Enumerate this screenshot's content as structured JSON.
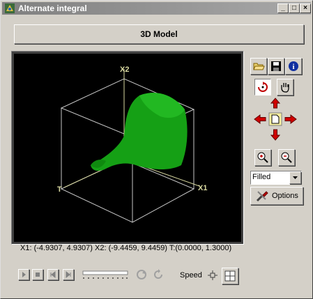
{
  "window": {
    "title": "Alternate integral"
  },
  "titlebar": {
    "minimize": "_",
    "maximize": "□",
    "close": "×"
  },
  "header": {
    "model_label": "3D Model"
  },
  "viewport": {
    "axis_x1": "X1",
    "axis_x2": "X2",
    "axis_t": "T"
  },
  "status": {
    "text": "X1: (-4.9307, 4.9307) X2: (-9.4459, 9.4459)  T:(0.0000, 1.3000)"
  },
  "render_mode": {
    "selected": "Filled"
  },
  "options": {
    "label": "Options"
  },
  "speed": {
    "label": "Speed"
  },
  "colors": {
    "surface": "#15a015",
    "axes": "#d8d8a0",
    "box": "#c8c8c8"
  }
}
